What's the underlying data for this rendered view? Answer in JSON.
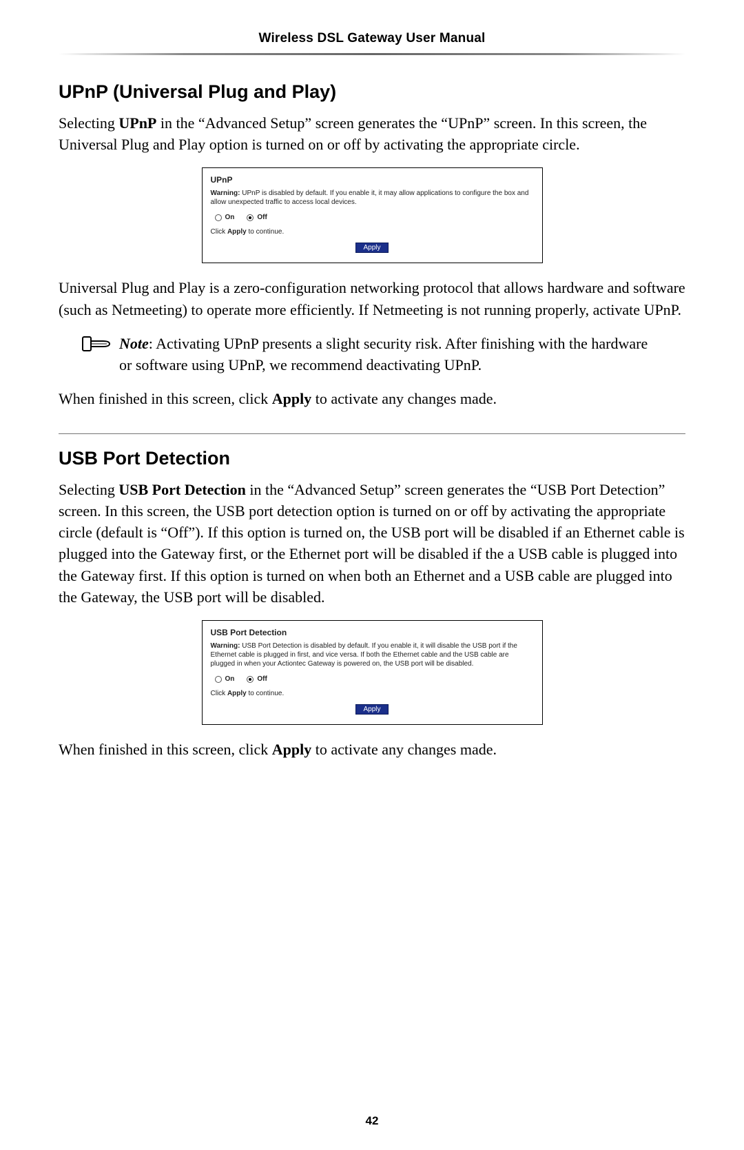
{
  "header": {
    "title": "Wireless DSL Gateway User Manual"
  },
  "upnp": {
    "heading": "UPnP (Universal Plug and Play)",
    "intro_html": "Selecting <b>UPnP</b> in the “Advanced Setup” screen generates the “UPnP” screen. In this screen, the Universal Plug and Play option is turned on or off by activating the appropriate circle.",
    "screenshot": {
      "title": "UPnP",
      "warning_label": "Warning:",
      "warning_text": " UPnP is disabled by default. If you enable it, it may allow applications to configure the box and allow unexpected traffic to access local devices.",
      "radio_on": "On",
      "radio_off": "Off",
      "selected": "off",
      "instruction_prefix": "Click ",
      "instruction_bold": "Apply",
      "instruction_suffix": " to continue.",
      "apply": "Apply"
    },
    "after_ss": "Universal Plug and Play is a zero-configuration networking protocol that allows hardware and software (such as Netmeeting) to operate more efficiently. If Netmeeting is not running properly, activate UPnP.",
    "note_label": "Note",
    "note_text": ": Activating UPnP presents a slight security risk. After finishing with the hardware or software using UPnP, we recommend deactivating UPnP.",
    "closing_html": "When finished in this screen, click <b>Apply</b> to activate any changes made."
  },
  "usb": {
    "heading": "USB Port Detection",
    "intro_html": "Selecting <b>USB Port Detection</b> in the “Advanced Setup” screen generates the “USB Port Detection” screen. In this screen, the USB port detection option is turned on or off by activating the appropriate circle (default is “Off”). If this option is turned on, the USB port will be disabled if an Ethernet cable is plugged into the Gateway first, or the Ethernet port will be disabled if the a USB cable is plugged into the Gateway first. If this option is turned on when both an Ethernet and a USB cable are plugged into the Gateway, the USB port will be disabled.",
    "screenshot": {
      "title": "USB Port Detection",
      "warning_label": "Warning:",
      "warning_text": " USB Port Detection is disabled by default. If you enable it, it will disable the USB port if the Ethernet cable is plugged in first, and vice versa. If both the Ethernet cable and the USB cable are plugged in when your Actiontec Gateway is powered on, the USB port will be disabled.",
      "radio_on": "On",
      "radio_off": "Off",
      "selected": "off",
      "instruction_prefix": "Click ",
      "instruction_bold": "Apply",
      "instruction_suffix": " to continue.",
      "apply": "Apply"
    },
    "closing_html": "When finished in this screen, click <b>Apply</b> to activate any changes made."
  },
  "page_number": "42"
}
